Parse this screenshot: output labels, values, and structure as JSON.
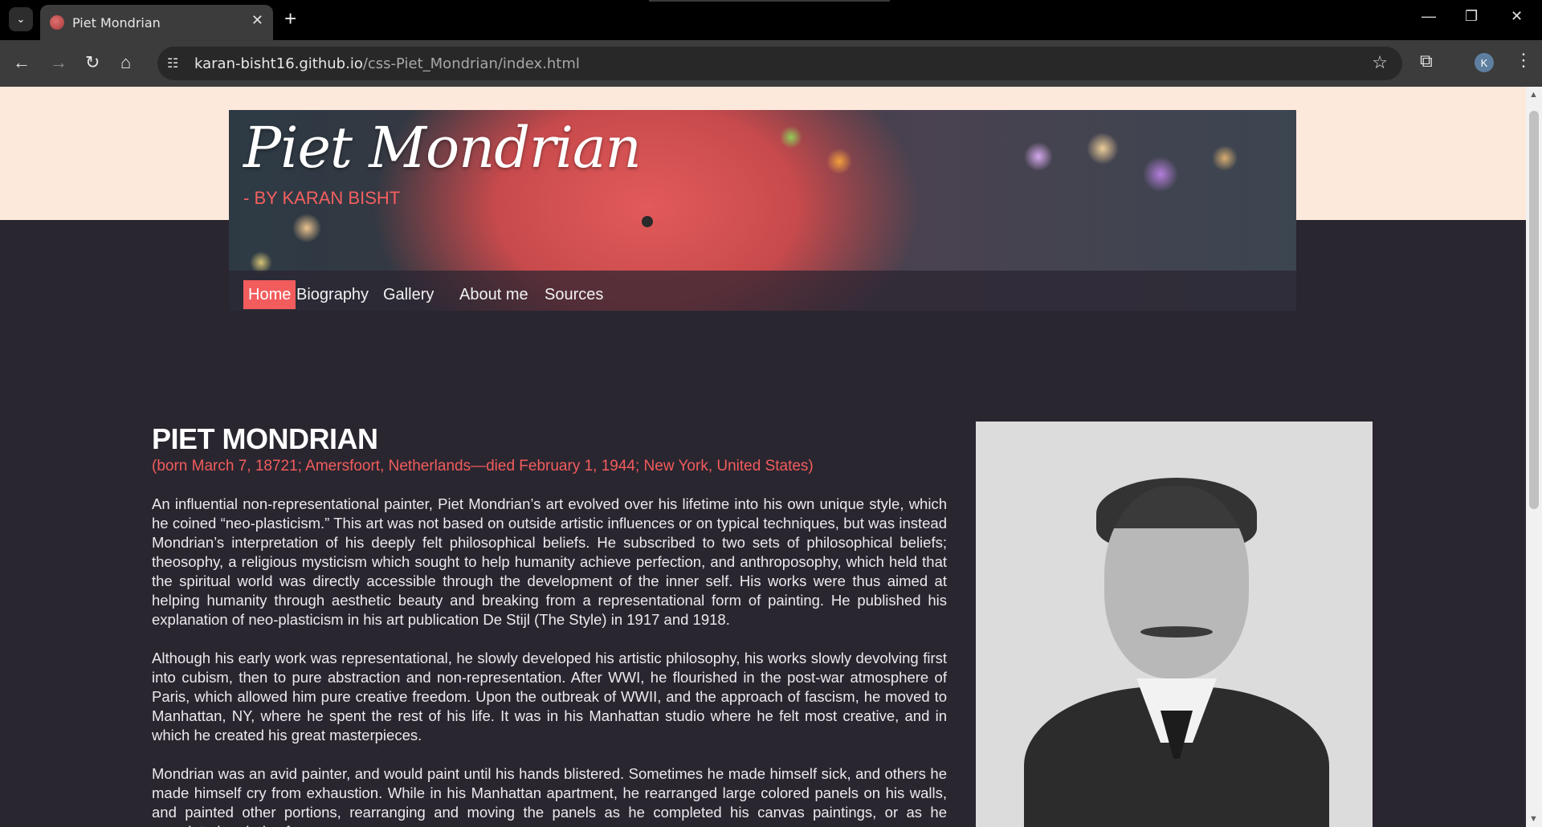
{
  "browser": {
    "tab_title": "Piet Mondrian",
    "url_host": "karan-bisht16.github.io",
    "url_path": "/css-Piet_Mondrian/index.html",
    "profile_initial": "K"
  },
  "header": {
    "title": "Piet Mondrian",
    "byline": "- BY KARAN BISHT"
  },
  "nav": {
    "items": [
      {
        "label": "Home",
        "active": true
      },
      {
        "label": "Biography"
      },
      {
        "label": "Gallery"
      },
      {
        "label": "About me"
      },
      {
        "label": "Sources"
      }
    ]
  },
  "main": {
    "heading": "PIET MONDRIAN",
    "born": "(born March 7, 18721; Amersfoort, Netherlands—died February 1, 1944; New York, United States)",
    "paragraphs": [
      "An influential non-representational painter, Piet Mondrian’s art evolved over his lifetime into his own unique style, which he coined “neo-plasticism.” This art was not based on outside artistic influences or on typical techniques, but was instead Mondrian’s interpretation of his deeply felt philosophical beliefs. He subscribed to two sets of philosophical beliefs; theosophy, a religious mysticism which sought to help humanity achieve perfection, and anthroposophy, which held that the spiritual world was directly accessible through the development of the inner self. His works were thus aimed at helping humanity through aesthetic beauty and breaking from a representational form of painting. He published his explanation of neo-plasticism in his art publication De Stijl (The Style) in 1917 and 1918.",
      "Although his early work was representational, he slowly developed his artistic philosophy, his works slowly devolving first into cubism, then to pure abstraction and non-representation. After WWI, he flourished in the post-war atmosphere of Paris, which allowed him pure creative freedom. Upon the outbreak of WWII, and the approach of fascism, he moved to Manhattan, NY, where he spent the rest of his life. It was in his Manhattan studio where he felt most creative, and in which he created his great masterpieces.",
      "Mondrian was an avid painter, and would paint until his hands blistered. Sometimes he made himself sick, and others he made himself cry from exhaustion. While in his Manhattan apartment, he rearranged large colored panels on his walls, and painted other portions, rearranging and moving the panels as he completed his canvas paintings, or as he completed periods of"
    ]
  },
  "colors": {
    "accent": "#f25c5c",
    "page_bg": "#2a2630",
    "header_band": "#fde8dc"
  }
}
